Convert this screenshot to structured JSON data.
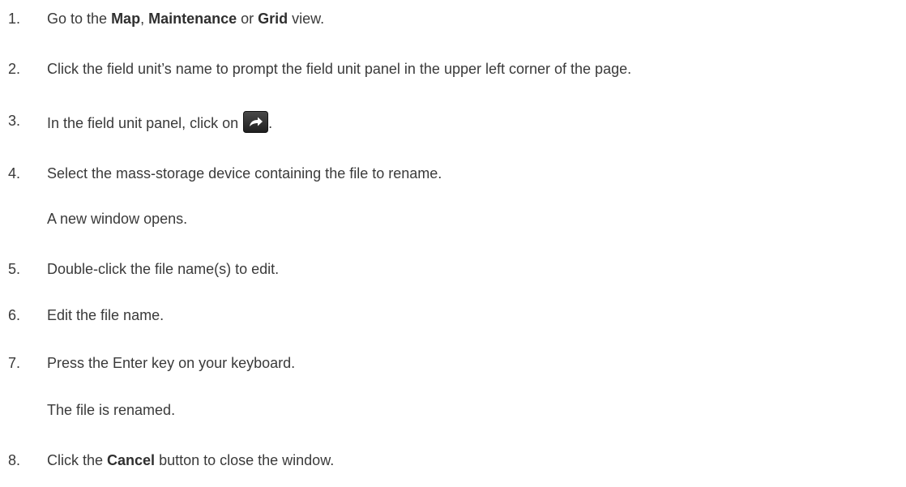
{
  "steps": [
    {
      "num": "1.",
      "parts": {
        "a": "Go to the ",
        "b1": "Map",
        "c": ", ",
        "b2": "Maintenance",
        "d": " or ",
        "b3": "Grid",
        "e": " view."
      }
    },
    {
      "num": "2.",
      "text": "Click the field unit’s name to prompt the field unit panel in the upper left corner of the page."
    },
    {
      "num": "3.",
      "text_before": "In the field unit panel, click on ",
      "text_after": ".",
      "icon": "forward-arrow-icon"
    },
    {
      "num": "4.",
      "text": "Select the mass-storage device containing the file to rename."
    },
    {
      "num": "5.",
      "text": "Double-click the file name(s) to edit."
    },
    {
      "num": "6.",
      "text": "Edit the file name."
    },
    {
      "num": "7.",
      "text": "Press the Enter key on your keyboard."
    },
    {
      "num": "8.",
      "parts": {
        "a": "Click the ",
        "b": "Cancel",
        "c": " button to close the window."
      }
    }
  ],
  "notes": {
    "after_step4": "A new window opens.",
    "after_step7": "The file is renamed."
  },
  "colors": {
    "text": "#3a3a3a",
    "icon_bg": "#2b2b2b",
    "icon_arrow": "#ffffff"
  }
}
